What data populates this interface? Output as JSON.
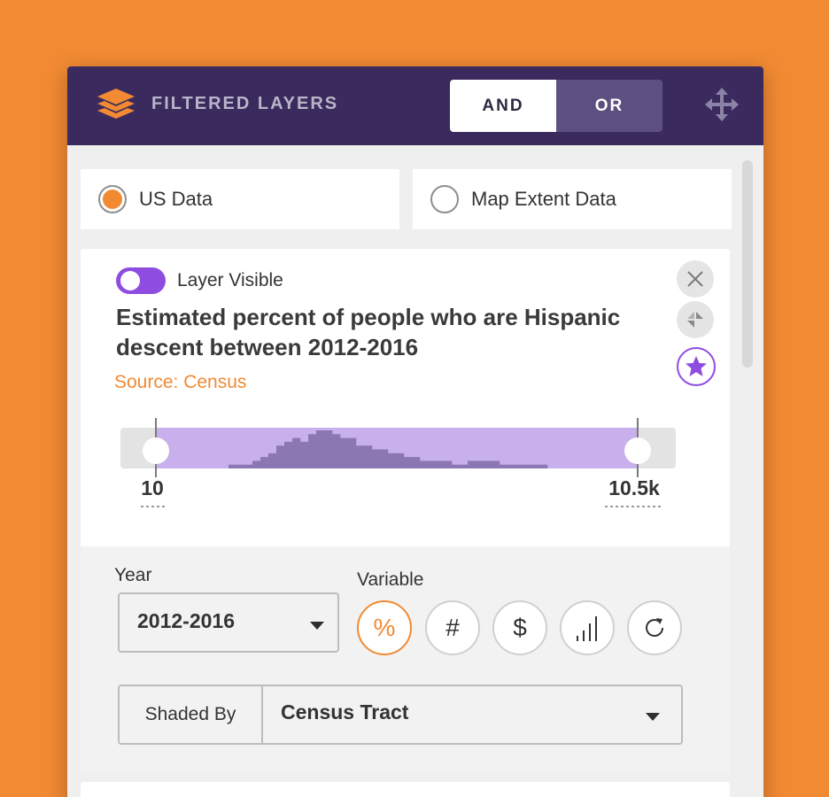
{
  "header": {
    "title": "FILTERED LAYERS",
    "logic": {
      "and_label": "AND",
      "or_label": "OR",
      "selected": "AND"
    },
    "icons": {
      "layers": "layers-stack-icon",
      "move": "move-arrows-icon"
    }
  },
  "data_scope": {
    "options": [
      {
        "label": "US Data",
        "selected": true
      },
      {
        "label": "Map Extent Data",
        "selected": false
      }
    ]
  },
  "layer": {
    "visible_label": "Layer Visible",
    "visible": true,
    "title": "Estimated percent of people who are Hispanic descent between 2012-2016",
    "source": "Source: Census",
    "actions": [
      "close-icon",
      "collapse-icon",
      "star-icon"
    ],
    "range": {
      "min_label": "10",
      "max_label": "10.5k",
      "histogram": [
        1,
        1,
        1,
        2,
        3,
        4,
        6,
        7,
        8,
        7,
        9,
        10,
        10,
        9,
        8,
        8,
        6,
        6,
        5,
        5,
        4,
        4,
        3,
        3,
        2,
        2,
        2,
        2,
        1,
        1,
        2,
        2,
        2,
        2,
        1,
        1,
        1,
        1,
        1,
        1
      ]
    }
  },
  "controls": {
    "year_label": "Year",
    "year_value": "2012-2016",
    "variable_label": "Variable",
    "variables": [
      {
        "name": "percent",
        "glyph": "%",
        "active": true
      },
      {
        "name": "count",
        "glyph": "#",
        "active": false
      },
      {
        "name": "dollar",
        "glyph": "$",
        "active": false
      },
      {
        "name": "bars",
        "glyph": "",
        "active": false
      },
      {
        "name": "refresh",
        "glyph": "",
        "active": false
      }
    ],
    "shaded_by_label": "Shaded By",
    "shaded_by_value": "Census Tract"
  },
  "colors": {
    "accent": "#F18A33",
    "header": "#3A2A5D",
    "purple": "#8F4CE0",
    "range_fill": "#C8B0EC",
    "histogram_bar": "#8B77B2"
  }
}
